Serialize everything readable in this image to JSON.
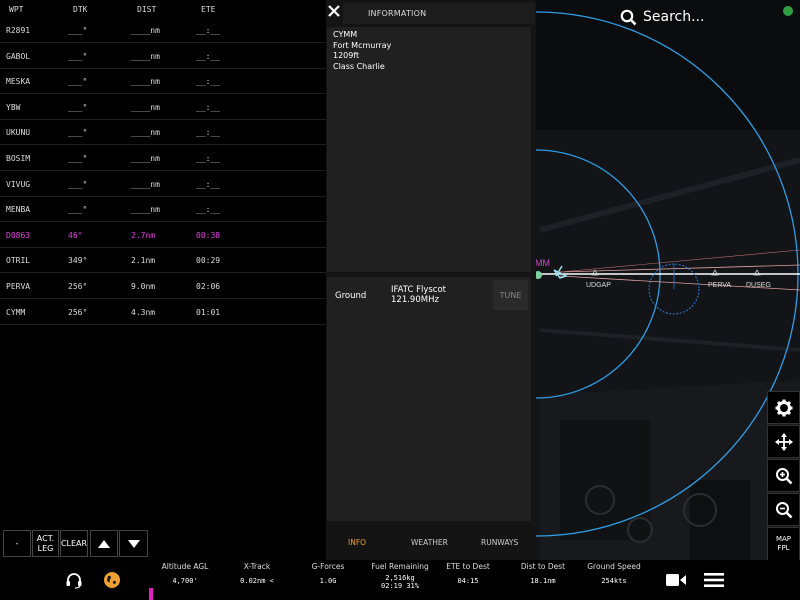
{
  "flightplan": {
    "headers": {
      "wpt": "WPT",
      "dtk": "DTK",
      "dist": "DIST",
      "ete": "ETE"
    },
    "rows": [
      {
        "wpt": "R2891",
        "dtk": "___°",
        "dist": "____nm",
        "ete": "__:__",
        "active": false
      },
      {
        "wpt": "GABOL",
        "dtk": "___°",
        "dist": "____nm",
        "ete": "__:__",
        "active": false
      },
      {
        "wpt": "MESKA",
        "dtk": "___°",
        "dist": "____nm",
        "ete": "__:__",
        "active": false
      },
      {
        "wpt": "YBW",
        "dtk": "___°",
        "dist": "____nm",
        "ete": "__:__",
        "active": false
      },
      {
        "wpt": "UKUNU",
        "dtk": "___°",
        "dist": "____nm",
        "ete": "__:__",
        "active": false
      },
      {
        "wpt": "BOSIM",
        "dtk": "___°",
        "dist": "____nm",
        "ete": "__:__",
        "active": false
      },
      {
        "wpt": "VIVUG",
        "dtk": "___°",
        "dist": "____nm",
        "ete": "__:__",
        "active": false
      },
      {
        "wpt": "MENBA",
        "dtk": "___°",
        "dist": "____nm",
        "ete": "__:__",
        "active": false
      },
      {
        "wpt": "D0863",
        "dtk": "46°",
        "dist": "2.7nm",
        "ete": "00:38",
        "active": true
      },
      {
        "wpt": "OTRIL",
        "dtk": "349°",
        "dist": "2.1nm",
        "ete": "00:29",
        "active": false
      },
      {
        "wpt": "PERVA",
        "dtk": "256°",
        "dist": "9.0nm",
        "ete": "02:06",
        "active": false
      },
      {
        "wpt": "CYMM",
        "dtk": "256°",
        "dist": "4.3nm",
        "ete": "01:01",
        "active": false
      }
    ],
    "buttons": {
      "dash": "-",
      "act_leg": "ACT. LEG",
      "clear": "CLEAR"
    }
  },
  "info": {
    "title": "INFORMATION",
    "lines": [
      "CYMM",
      "Fort Mcmurray",
      "1209ft",
      "Class Charlie"
    ],
    "frequency": {
      "name": "Ground",
      "station": "IFATC Flyscot",
      "mhz": "121.90MHz",
      "tune_label": "TUNE"
    },
    "tabs": [
      {
        "label": "INFO",
        "active": true
      },
      {
        "label": "WEATHER",
        "active": false
      },
      {
        "label": "RUNWAYS",
        "active": false
      }
    ]
  },
  "search": {
    "label": "Search..."
  },
  "map": {
    "partial_label": "MM",
    "waypoints": [
      "UDGAP",
      "PERVA",
      "DUSEG"
    ],
    "range_ring_color": "#2e9ee8",
    "status_color": "#2ea043",
    "map_fpl_label": "MAP FPL"
  },
  "stats": [
    {
      "label": "Altitude AGL",
      "value": "4,700'"
    },
    {
      "label": "X-Track",
      "value": "0.02nm <"
    },
    {
      "label": "G-Forces",
      "value": "1.0G"
    },
    {
      "label": "Fuel Remaining",
      "value": "2,516kg",
      "value2": "02:19 31%"
    },
    {
      "label": "ETE to Dest",
      "value": "04:15"
    },
    {
      "label": "Dist to Dest",
      "value": "18.1nm"
    },
    {
      "label": "Ground Speed",
      "value": "254kts"
    }
  ]
}
